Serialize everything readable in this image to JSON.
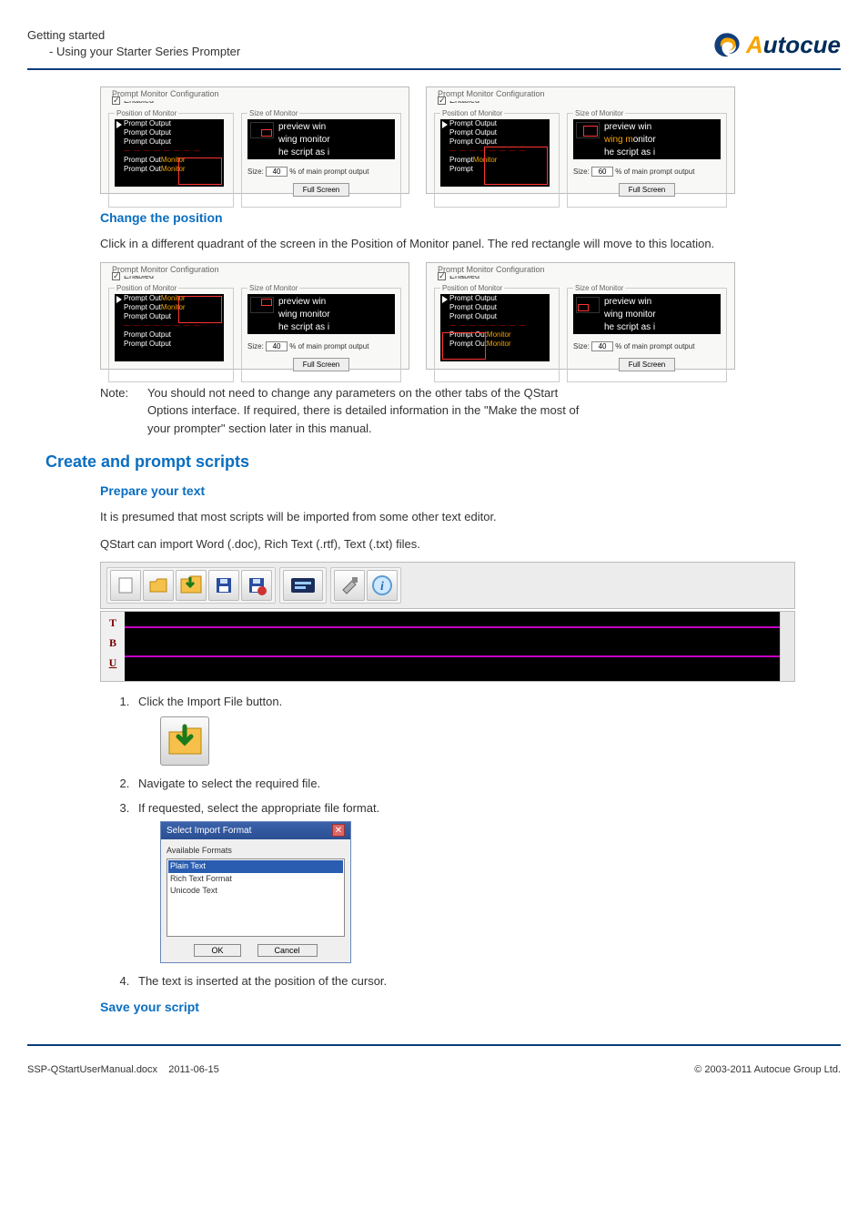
{
  "header": {
    "line1": "Getting started",
    "line2": "- Using your Starter Series Prompter",
    "logo_text": "utocue"
  },
  "panels": {
    "config_title": "Prompt Monitor Configuration",
    "enabled_label": "Enabled",
    "position_label": "Position of Monitor",
    "size_label": "Size of Monitor",
    "prompt_output": "Prompt Output",
    "prompt_out": "Prompt Out",
    "prompt": "Prompt",
    "monitor": "Monitor",
    "preview_a": "preview win",
    "preview_b": "wing monitor",
    "preview_c": "he script as i",
    "size_word": "Size:",
    "size_val_40": "40",
    "size_val_60": "60",
    "size_suffix": "% of main prompt output",
    "full_screen": "Full Screen"
  },
  "headings": {
    "change_pos": "Change the position",
    "create_prompt": "Create and prompt scripts",
    "prepare": "Prepare your text",
    "save": "Save your script"
  },
  "body": {
    "click_quadrant": "Click in a different quadrant of the screen in the Position of Monitor panel. The red rectangle will move to this location.",
    "note_label": "Note:",
    "note_text1": "You should not need to change any parameters on the other tabs of the QStart",
    "note_text2": "Options interface. If required, there is detailed information in the \"Make the most of",
    "note_text3": "your prompter\" section later in this manual.",
    "presumed": "It is presumed that most scripts will be imported from some other text editor.",
    "import_types": "QStart can import Word (.doc), Rich Text (.rtf), Text (.txt) files."
  },
  "steps": {
    "s1": "Click the Import File button.",
    "s2": "Navigate to select the required file.",
    "s3": "If requested, select the appropriate file format.",
    "s4": "The text is inserted at the position of the cursor."
  },
  "dialog": {
    "title": "Select Import Format",
    "avail": "Available Formats",
    "opt1": "Plain Text",
    "opt2": "Rich Text Format",
    "opt3": "Unicode Text",
    "ok": "OK",
    "cancel": "Cancel"
  },
  "editor_side": {
    "t": "T",
    "b": "B",
    "u": "U"
  },
  "footer": {
    "left1": "SSP-QStartUserManual.docx",
    "left2": "2011-06-15",
    "right": "© 2003-2011 Autocue Group Ltd."
  }
}
